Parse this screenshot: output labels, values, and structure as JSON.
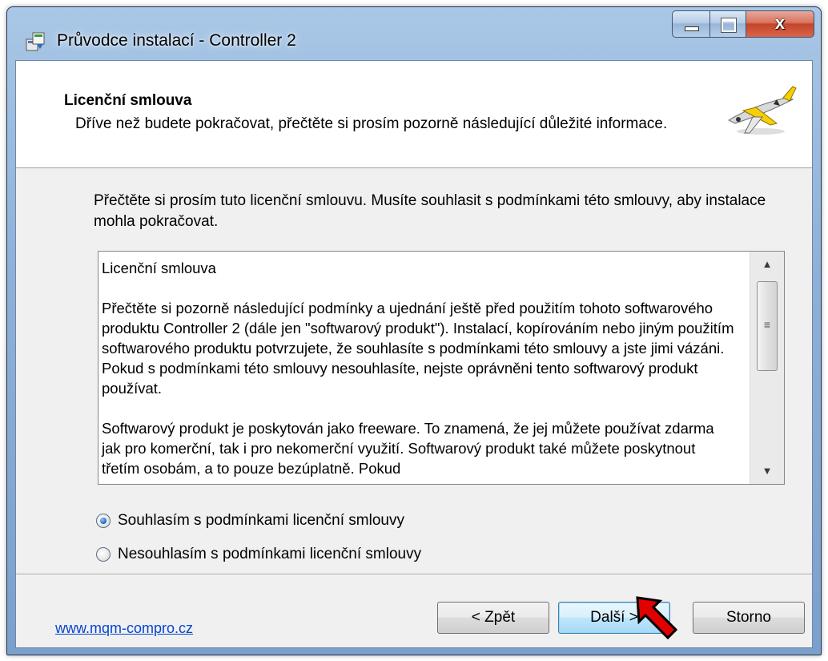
{
  "window": {
    "title": "Průvodce instalací - Controller 2",
    "close_glyph": "x"
  },
  "header": {
    "title": "Licenční smlouva",
    "subtitle": "Dříve než budete pokračovat, přečtěte si prosím pozorně následující důležité informace."
  },
  "instruction": "Přečtěte si prosím tuto licenční smlouvu. Musíte souhlasit s podmínkami této smlouvy, aby instalace mohla pokračovat.",
  "license": {
    "text": "Licenční smlouva\n\nPřečtěte si pozorně následující podmínky a ujednání ještě před použitím tohoto softwarového produktu Controller 2 (dále jen \"softwarový produkt\"). Instalací, kopírováním nebo jiným použitím softwarového produktu potvrzujete, že souhlasíte s podmínkami této smlouvy a jste jimi vázáni. Pokud s podmínkami této smlouvy nesouhlasíte, nejste oprávněni tento softwarový produkt používat.\n\nSoftwarový produkt je poskytován jako freeware. To znamená, že jej můžete používat zdarma jak pro komerční, tak i pro nekomerční využití. Softwarový produkt také můžete poskytnout třetím osobám, a to pouze bezúplatně. Pokud"
  },
  "options": {
    "accept_label": "Souhlasím s podmínkami licenční smlouvy",
    "decline_label": "Nesouhlasím s podmínkami licenční smlouvy",
    "selected": "accept"
  },
  "footer": {
    "link_text": "www.mqm-compro.cz",
    "back_label": "< Zpět",
    "next_label": "Další >",
    "cancel_label": "Storno"
  },
  "colors": {
    "link": "#0645d0",
    "annotation_arrow": "#e00000"
  },
  "icons": {
    "app": "installer-icon",
    "header": "airplane-icon",
    "annotation": "red-arrow-icon"
  }
}
